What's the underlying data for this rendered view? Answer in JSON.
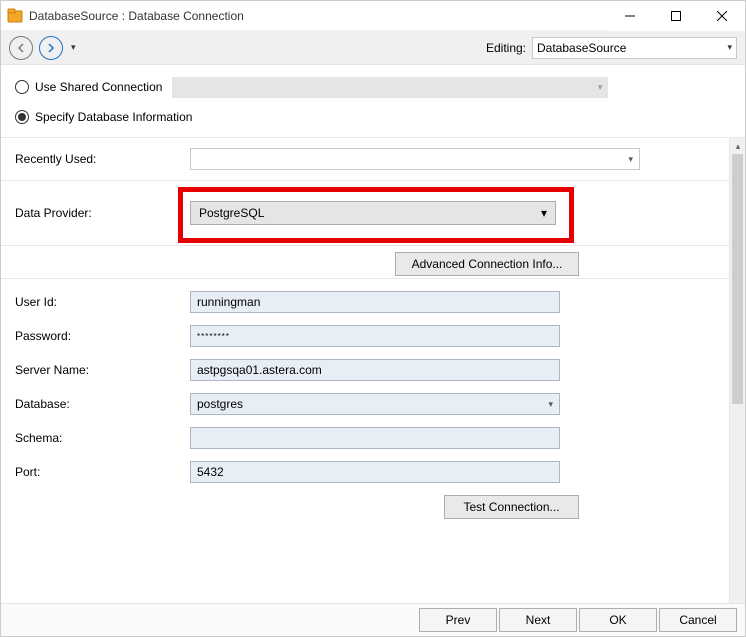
{
  "window": {
    "title": "DatabaseSource : Database Connection"
  },
  "toolbar": {
    "editing_label": "Editing:",
    "editing_value": "DatabaseSource"
  },
  "mode": {
    "shared_label": "Use Shared Connection",
    "specify_label": "Specify Database Information",
    "selected": "specify"
  },
  "form": {
    "recently_used_label": "Recently Used:",
    "recently_used_value": "",
    "data_provider_label": "Data Provider:",
    "data_provider_value": "PostgreSQL",
    "advanced_btn": "Advanced Connection Info...",
    "user_id_label": "User Id:",
    "user_id_value": "runningman",
    "password_label": "Password:",
    "password_value": "********",
    "server_label": "Server Name:",
    "server_value": "astpgsqa01.astera.com",
    "database_label": "Database:",
    "database_value": "postgres",
    "schema_label": "Schema:",
    "schema_value": "",
    "port_label": "Port:",
    "port_value": "5432",
    "test_btn": "Test Connection..."
  },
  "footer": {
    "prev": "Prev",
    "next": "Next",
    "ok": "OK",
    "cancel": "Cancel"
  }
}
